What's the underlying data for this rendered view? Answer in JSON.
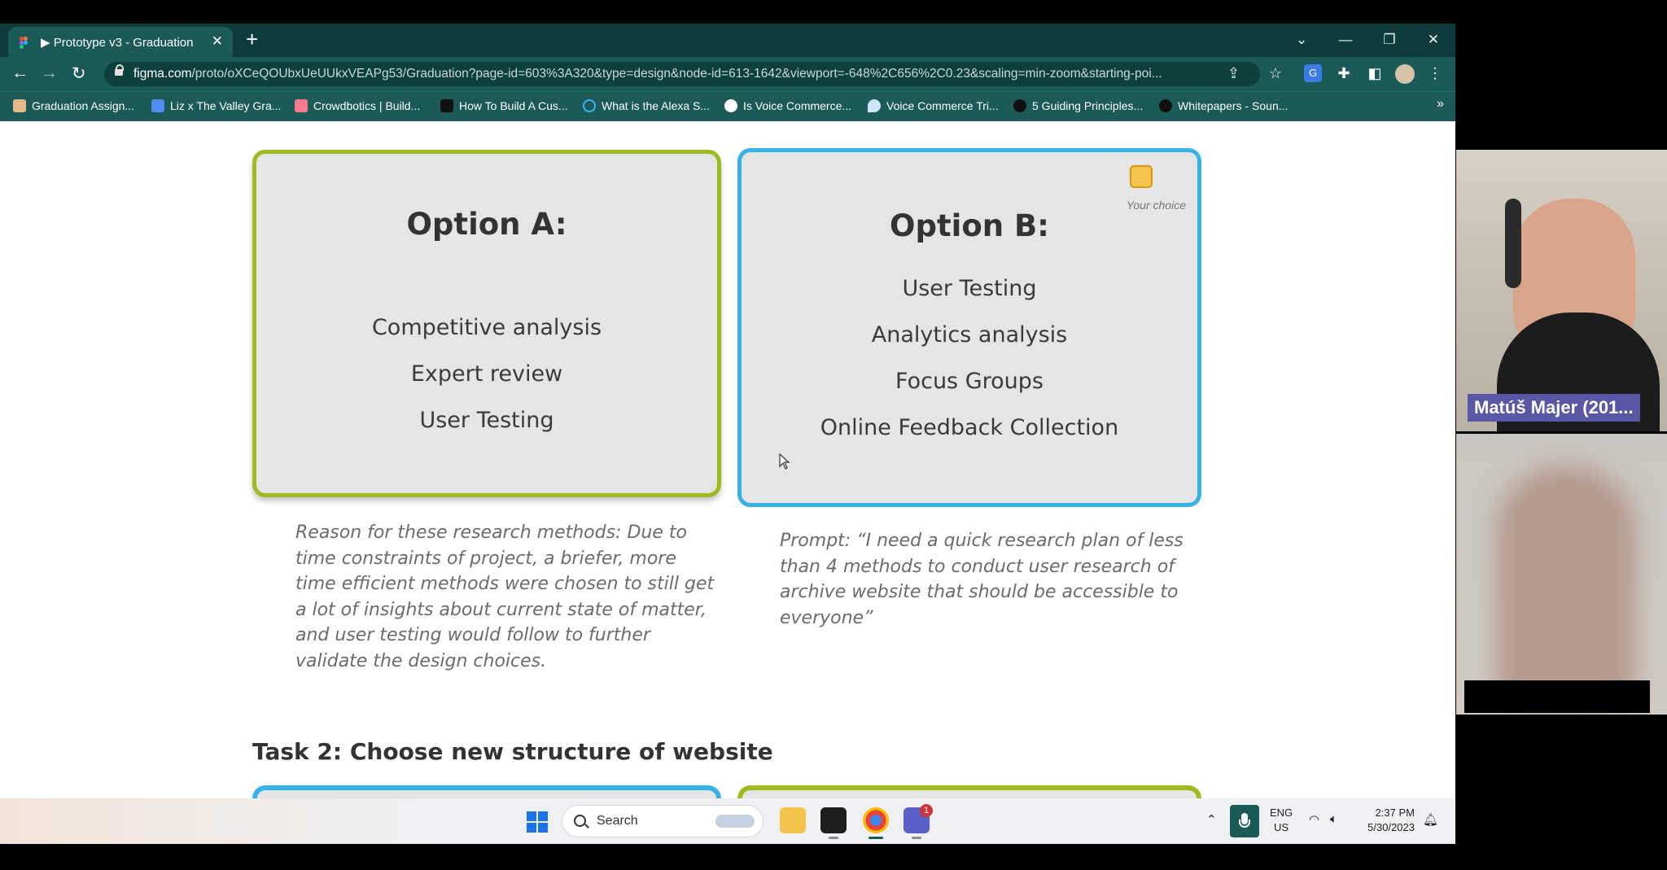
{
  "browser": {
    "tab": {
      "title": "▶ Prototype v3 - Graduation"
    },
    "url": {
      "domain": "figma.com",
      "path": "/proto/oXCeQOUbxUeUUkxVEAPg53/Graduation?page-id=603%3A320&type=design&node-id=613-1642&viewport=-648%2C656%2C0.23&scaling=min-zoom&starting-poi..."
    },
    "bookmarks": [
      {
        "label": "Graduation Assign...",
        "icon": "stack-icon",
        "color": "#e7b98a"
      },
      {
        "label": "Liz x The Valley Gra...",
        "icon": "docs-icon",
        "color": "#4d8ff5"
      },
      {
        "label": "Crowdbotics | Build...",
        "icon": "crowdbotics-icon",
        "color": "#ff7a90"
      },
      {
        "label": "How To Build A Cus...",
        "icon": "medium-icon",
        "color": "#111111"
      },
      {
        "label": "What is the Alexa S...",
        "icon": "alexa-icon",
        "color": "#38b6ff"
      },
      {
        "label": "Is Voice Commerce...",
        "icon": "globe-icon",
        "color": "#ffffff"
      },
      {
        "label": "Voice Commerce Tri...",
        "icon": "drop-icon",
        "color": "#cfe4ff"
      },
      {
        "label": "5 Guiding Principles...",
        "icon": "s-icon",
        "color": "#111111"
      },
      {
        "label": "Whitepapers - Soun...",
        "icon": "s-icon",
        "color": "#111111"
      }
    ]
  },
  "content": {
    "option_a": {
      "title": "Option A:",
      "items": [
        "Competitive analysis",
        "Expert review",
        "User Testing"
      ],
      "reason_lines": [
        "Reason for these research methods: Due to",
        "time constraints of project, a briefer, more",
        "time efficient methods were chosen to still get",
        "a lot of insights about current state of matter,",
        "and user testing would follow to further",
        "validate the design choices."
      ]
    },
    "option_b": {
      "title": "Option B:",
      "choice_label": "Your choice",
      "items": [
        "User Testing",
        "Analytics analysis",
        "Focus Groups",
        "Online Feedback Collection"
      ],
      "prompt_lines": [
        "Prompt: “I need a quick research plan of less",
        "than 4 methods to conduct user research of",
        "archive website that should be accessible to",
        "everyone”"
      ]
    },
    "task2_title": "Task 2: Choose new structure of website",
    "colors": {
      "option_a_border": "#9dbb1f",
      "option_b_border": "#36b2e6",
      "choice_badge": "#f6c34b"
    }
  },
  "taskbar": {
    "search_label": "Search",
    "lang_line1": "ENG",
    "lang_line2": "US",
    "time": "2:37 PM",
    "date": "5/30/2023",
    "teams_badge": "1"
  },
  "call": {
    "participant_1": "Matúš Majer (201..."
  }
}
